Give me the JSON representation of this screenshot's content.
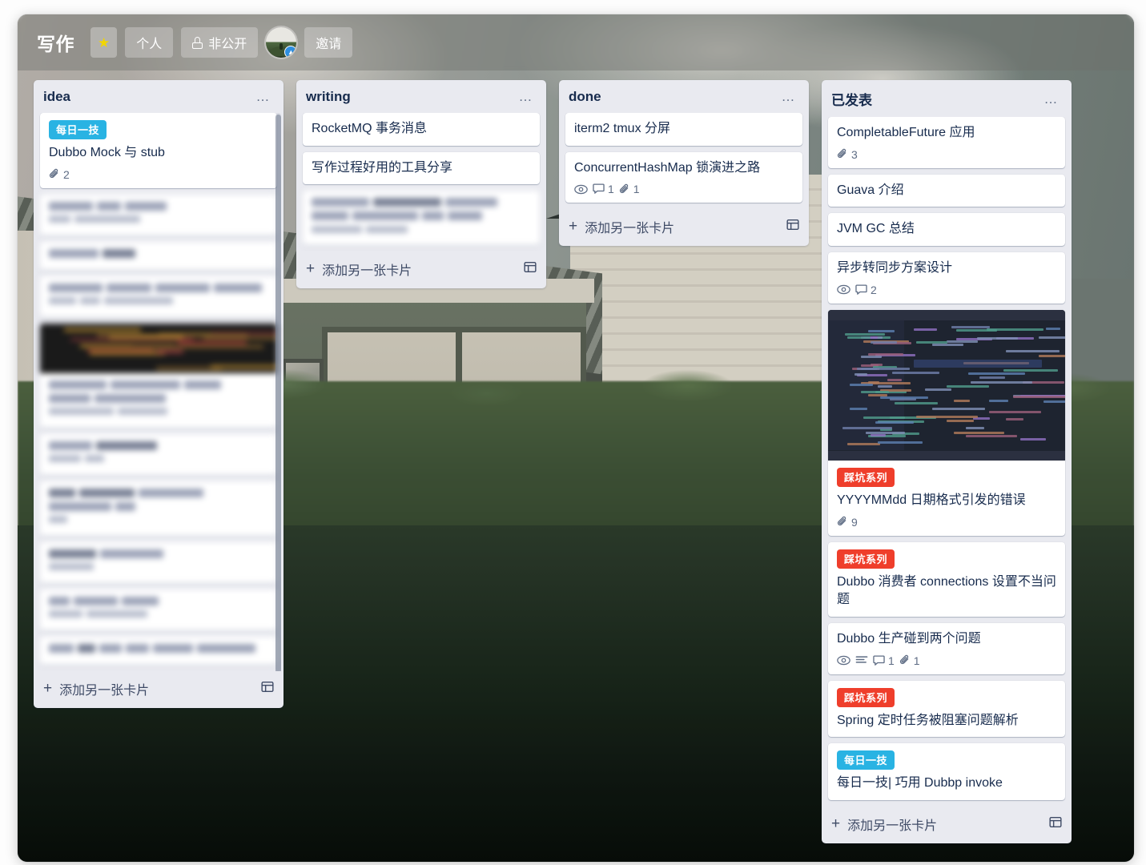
{
  "header": {
    "board_title": "写作",
    "star_icon": "star-icon",
    "workspace_label": "个人",
    "visibility_label": "非公开",
    "visibility_icon": "lock-icon",
    "avatar_name": "user-avatar",
    "avatar_badge_icon": "verified-badge-icon",
    "invite_label": "邀请"
  },
  "colors": {
    "label_blue": "#29b3e3",
    "label_red": "#ef3e2b",
    "list_bg": "#e9eaf0",
    "card_bg": "#ffffff",
    "text": "#172b4d",
    "muted": "#5e6c84"
  },
  "add_card_label": "添加另一张卡片",
  "lists": [
    {
      "title": "idea",
      "menu_icon": "list-menu-icon",
      "cards": [
        {
          "label": "每日一技",
          "label_color": "#29b3e3",
          "title": "Dubbo Mock 与 stub",
          "badges": [
            {
              "icon": "attachment-icon",
              "value": "2"
            }
          ]
        },
        {
          "blurred": true,
          "lines": [
            3,
            2
          ]
        },
        {
          "blurred": true,
          "lines": [
            2
          ]
        },
        {
          "blurred": true,
          "lines": [
            4,
            3
          ]
        },
        {
          "blurred": true,
          "cover": "terminal",
          "lines": [
            5,
            2
          ]
        },
        {
          "blurred": true,
          "lines": [
            2,
            2
          ]
        },
        {
          "blurred": true,
          "lines": [
            5,
            1
          ]
        },
        {
          "blurred": true,
          "lines": [
            2,
            1
          ]
        },
        {
          "blurred": true,
          "lines": [
            3,
            2
          ]
        },
        {
          "blurred": true,
          "lines": [
            6
          ]
        }
      ]
    },
    {
      "title": "writing",
      "menu_icon": "list-menu-icon",
      "cards": [
        {
          "title": "RocketMQ 事务消息",
          "badges": []
        },
        {
          "title": "写作过程好用的工具分享",
          "badges": []
        },
        {
          "blurred": true,
          "lines": [
            7,
            2
          ]
        }
      ]
    },
    {
      "title": "done",
      "menu_icon": "list-menu-icon",
      "cards": [
        {
          "title": "iterm2 tmux 分屏",
          "badges": []
        },
        {
          "title": "ConcurrentHashMap 锁演进之路",
          "badges": [
            {
              "icon": "eye-icon",
              "value": ""
            },
            {
              "icon": "comment-icon",
              "value": "1"
            },
            {
              "icon": "attachment-icon",
              "value": "1"
            }
          ]
        }
      ]
    },
    {
      "title": "已发表",
      "menu_icon": "list-menu-icon",
      "cards": [
        {
          "title": "CompletableFuture 应用",
          "badges": [
            {
              "icon": "attachment-icon",
              "value": "3"
            }
          ]
        },
        {
          "title": "Guava 介绍",
          "badges": []
        },
        {
          "title": "JVM GC 总结",
          "badges": []
        },
        {
          "title": "异步转同步方案设计",
          "badges": [
            {
              "icon": "eye-icon",
              "value": ""
            },
            {
              "icon": "comment-icon",
              "value": "2"
            }
          ]
        },
        {
          "cover": "code-editor",
          "label": "踩坑系列",
          "label_color": "#ef3e2b",
          "title": "YYYYMMdd 日期格式引发的错误",
          "badges": [
            {
              "icon": "attachment-icon",
              "value": "9"
            }
          ]
        },
        {
          "label": "踩坑系列",
          "label_color": "#ef3e2b",
          "title": "Dubbo 消费者 connections 设置不当问题",
          "badges": []
        },
        {
          "title": "Dubbo 生产碰到两个问题",
          "badges": [
            {
              "icon": "eye-icon",
              "value": ""
            },
            {
              "icon": "description-icon",
              "value": ""
            },
            {
              "icon": "comment-icon",
              "value": "1"
            },
            {
              "icon": "attachment-icon",
              "value": "1"
            }
          ]
        },
        {
          "label": "踩坑系列",
          "label_color": "#ef3e2b",
          "title": "Spring 定时任务被阻塞问题解析",
          "badges": []
        },
        {
          "label": "每日一技",
          "label_color": "#29b3e3",
          "title": "每日一技| 巧用 Dubbp invoke",
          "badges": []
        }
      ]
    }
  ]
}
